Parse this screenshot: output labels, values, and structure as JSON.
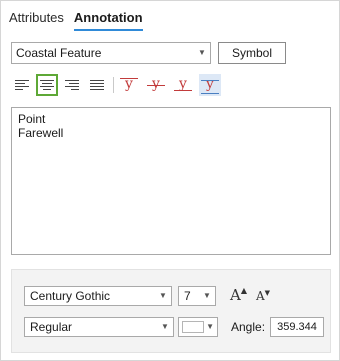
{
  "tabs": [
    {
      "label": "Attributes"
    },
    {
      "label": "Annotation"
    }
  ],
  "feature_class": {
    "value": "Coastal Feature"
  },
  "symbol_button": {
    "label": "Symbol"
  },
  "toolbar": {
    "align_left_icon": "align-left-icon",
    "align_center_icon": "align-center-icon",
    "align_right_icon": "align-right-icon",
    "justify_icon": "justify-icon",
    "y_glyph": "y",
    "accent_color": "#c23b3b",
    "selected_color": "#5ea836"
  },
  "text_content": {
    "lines": [
      "Point",
      "Farewell"
    ]
  },
  "font": {
    "family": "Century Gothic",
    "size": "7",
    "style": "Regular",
    "increase_glyph": "A",
    "decrease_glyph": "A"
  },
  "angle": {
    "label": "Angle:",
    "value": "359.344"
  }
}
